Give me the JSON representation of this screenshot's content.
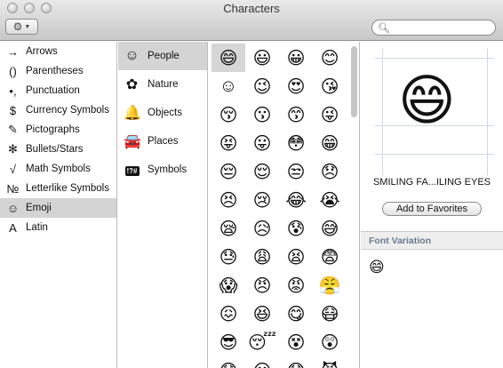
{
  "window": {
    "title": "Characters"
  },
  "search": {
    "placeholder": "",
    "value": ""
  },
  "categories": [
    {
      "label": "Arrows",
      "icon": "→"
    },
    {
      "label": "Parentheses",
      "icon": "()"
    },
    {
      "label": "Punctuation",
      "icon": "•,"
    },
    {
      "label": "Currency Symbols",
      "icon": "$"
    },
    {
      "label": "Pictographs",
      "icon": "✎"
    },
    {
      "label": "Bullets/Stars",
      "icon": "✻"
    },
    {
      "label": "Math Symbols",
      "icon": "√"
    },
    {
      "label": "Letterlike Symbols",
      "icon": "№"
    },
    {
      "label": "Emoji",
      "icon": "☺",
      "selected": true
    },
    {
      "label": "Latin",
      "icon": "A"
    }
  ],
  "subcategories": [
    {
      "label": "People",
      "icon": "☺",
      "selected": true
    },
    {
      "label": "Nature",
      "icon": "✿"
    },
    {
      "label": "Objects",
      "icon": "🔔"
    },
    {
      "label": "Places",
      "icon": "🚘"
    },
    {
      "label": "Symbols",
      "icon": "!?#"
    }
  ],
  "emoji_grid": [
    "😄",
    "😃",
    "😀",
    "😊",
    "☺",
    "😉",
    "😍",
    "😘",
    "😚",
    "😗",
    "😙",
    "😜",
    "😝",
    "😛",
    "😳",
    "😁",
    "😔",
    "😌",
    "😒",
    "😞",
    "😣",
    "😢",
    "😂",
    "😭",
    "😪",
    "😥",
    "😰",
    "😅",
    "😓",
    "😩",
    "😫",
    "😨",
    "😱",
    "😠",
    "😡",
    "😤",
    "😖",
    "😆",
    "😋",
    "😷",
    "😎",
    "😴",
    "😵",
    "😲",
    "😟",
    "😦",
    "😧",
    "😈"
  ],
  "selected_emoji": "😄",
  "preview": {
    "glyph": "😄",
    "name": "SMILING FA...ILING EYES",
    "add_favorites_label": "Add to Favorites"
  },
  "font_variation": {
    "header": "Font Variation",
    "items": [
      "😄"
    ]
  },
  "icons": {
    "gear": "gear-icon",
    "search": "search-icon"
  }
}
